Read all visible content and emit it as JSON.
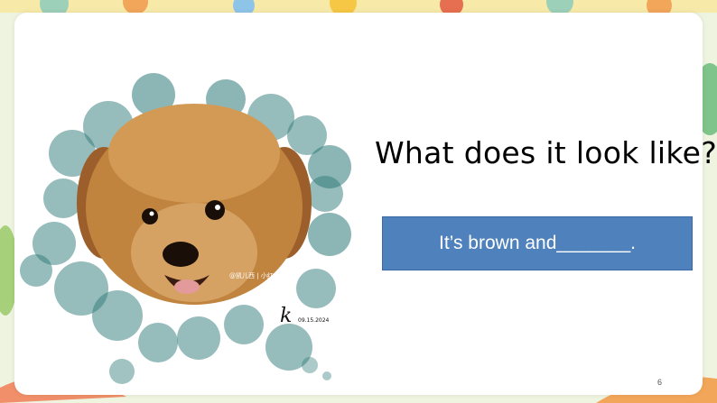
{
  "slide": {
    "question": "What does it look like?",
    "answer": "It’s brown and_______.",
    "page_number": "6"
  },
  "image": {
    "watermark": "@凯儿西 | 小红书",
    "signature": "k",
    "signature_date": "09.15.2024"
  },
  "colors": {
    "answer_box": "#4f81bd",
    "bubbles": "#2e7a78",
    "dog_fur": "#b0733a"
  }
}
